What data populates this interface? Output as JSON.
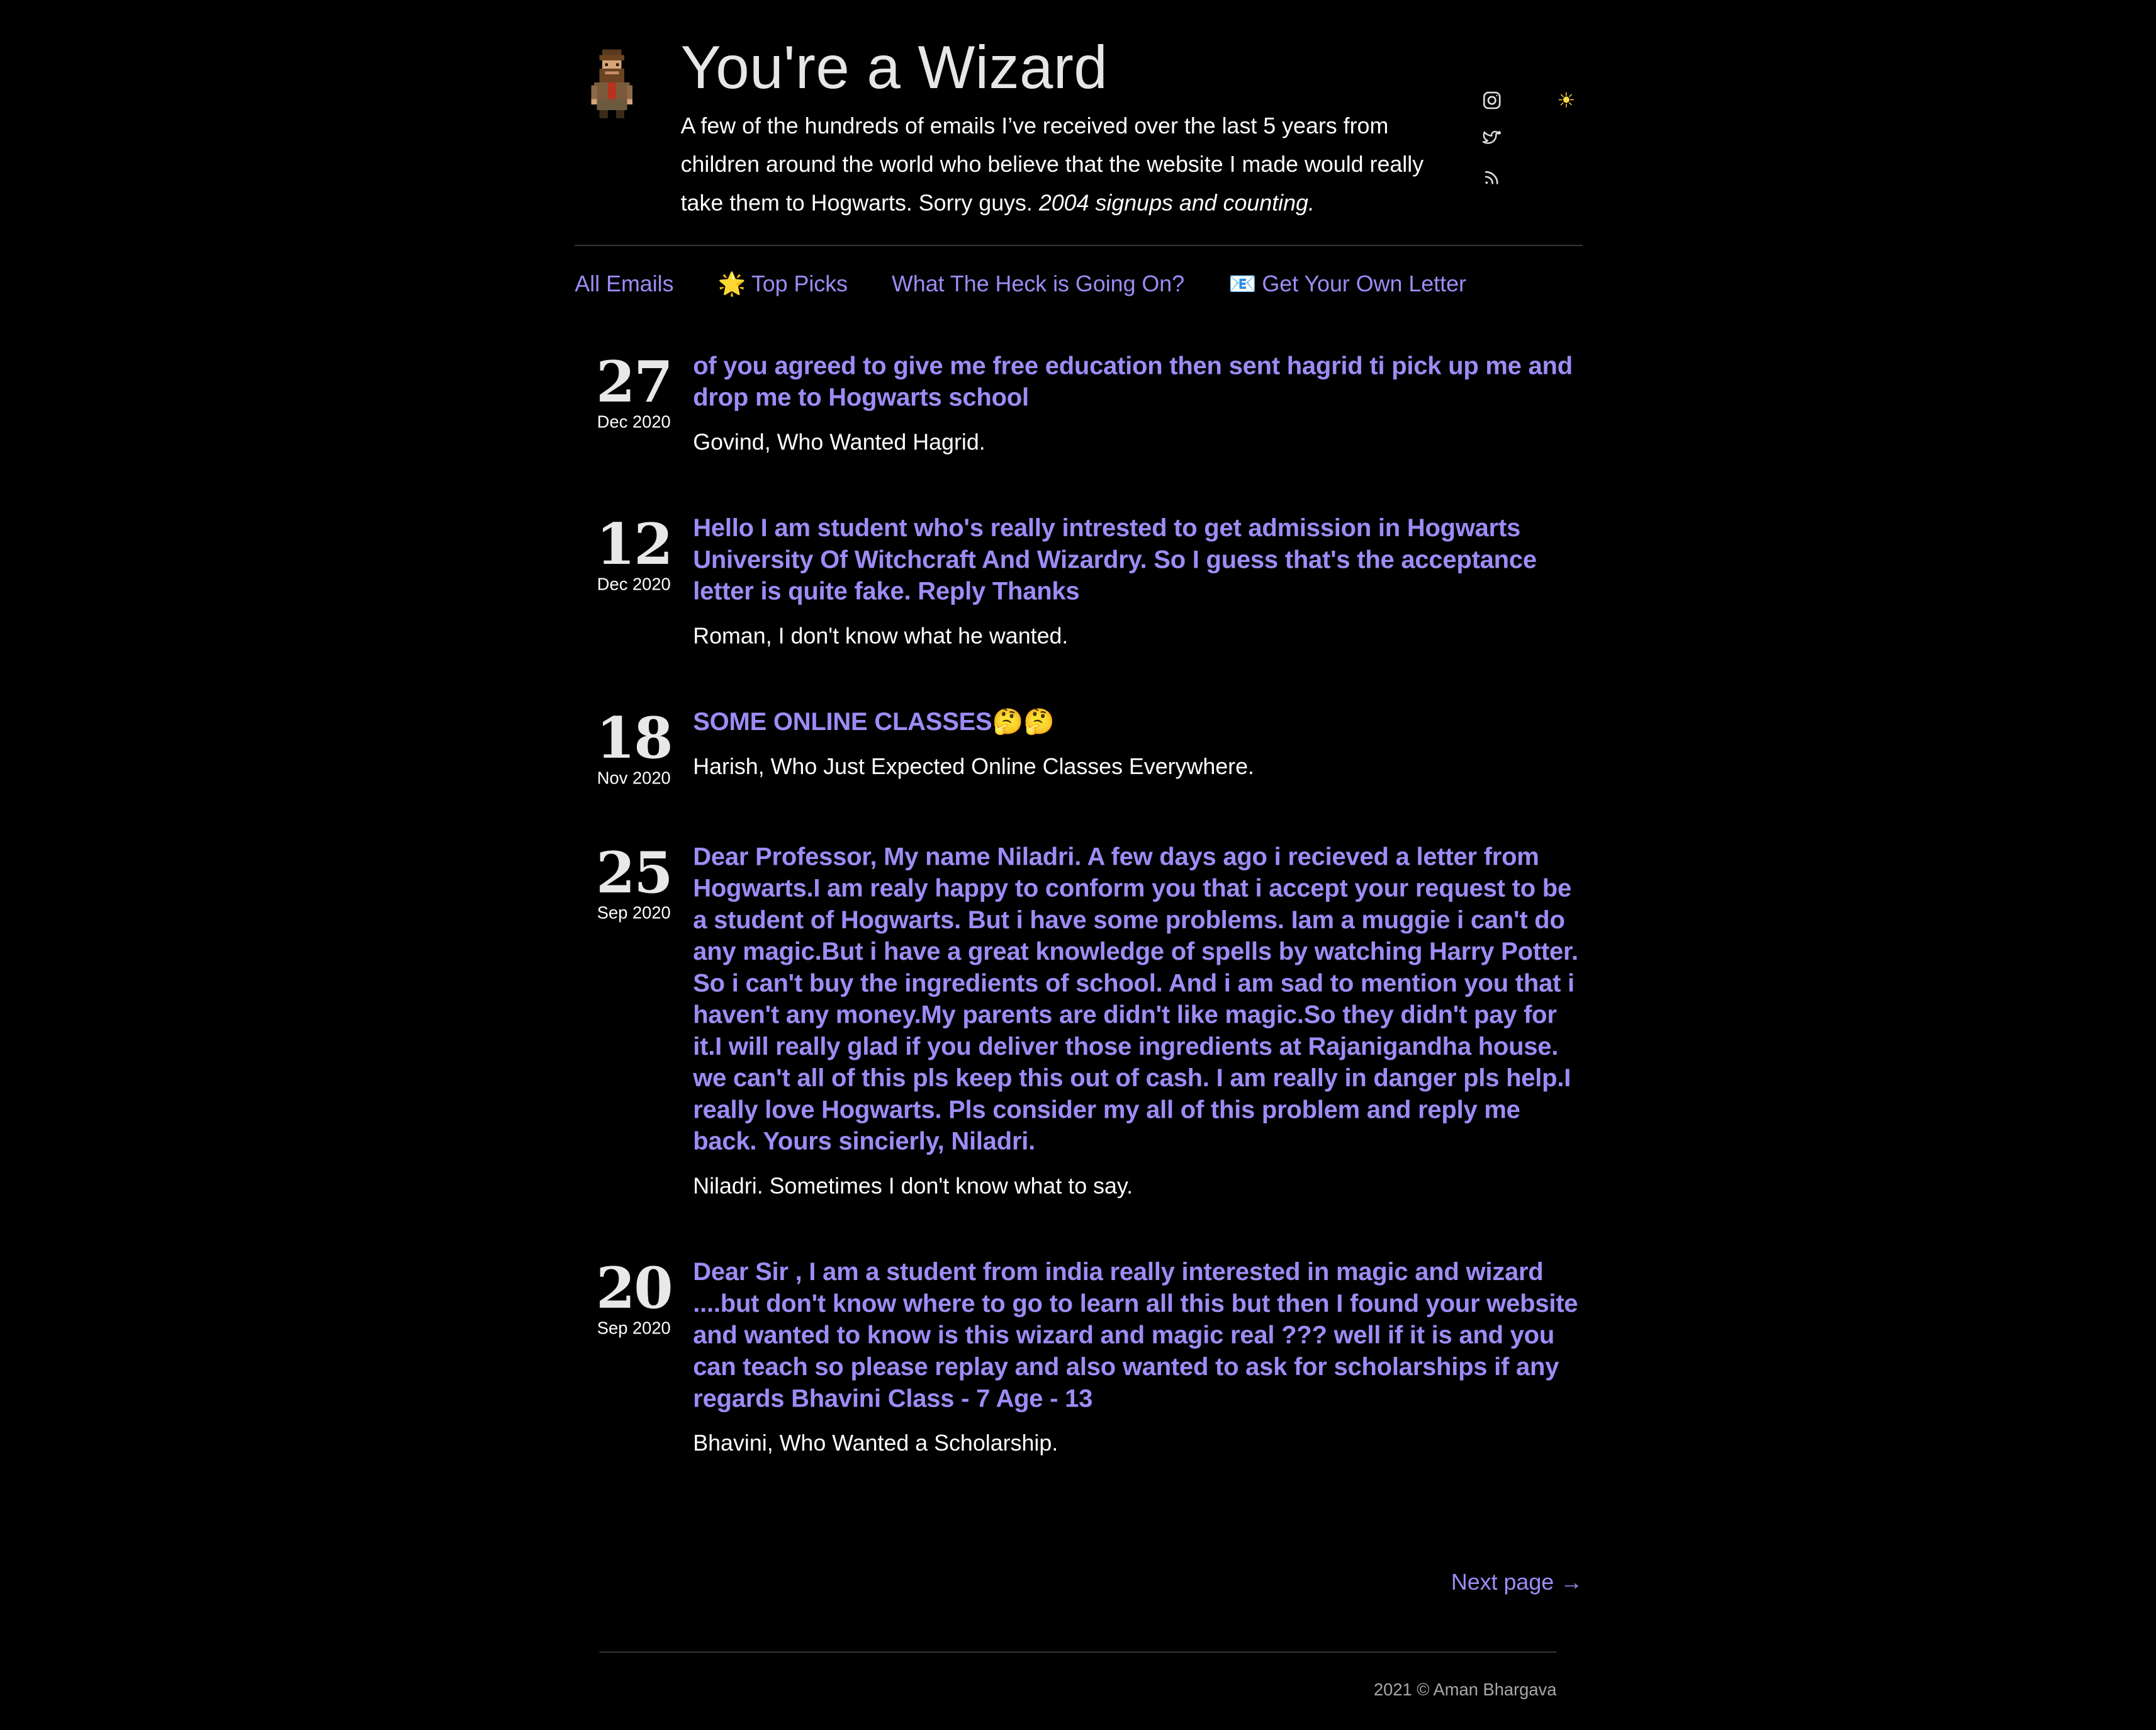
{
  "header": {
    "title": "You're a Wizard",
    "intro_text": "A few of the hundreds of emails I’ve received over the last 5 years from children around the world who believe that the website I made would really take them to Hogwarts. Sorry guys. ",
    "intro_emphasis": "2004 signups and counting.",
    "avatar_icon": "pixel-wizard-avatar",
    "social_icons": [
      "instagram-icon",
      "twitter-icon",
      "rss-icon"
    ],
    "theme_toggle_glyph": "☀",
    "theme_toggle_icon": "sun-icon"
  },
  "nav": {
    "all_emails": "All Emails",
    "top_picks_emoji": "🌟",
    "top_picks": "Top Picks",
    "what_the_heck": "What The Heck is Going On?",
    "get_letter_emoji": "📧",
    "get_letter": "Get Your Own Letter"
  },
  "entries": [
    {
      "day": "27",
      "month": "Dec 2020",
      "subject": "of you agreed to give me free education then sent hagrid ti pick up me and drop me to Hogwarts school",
      "signoff": "Govind, Who Wanted Hagrid."
    },
    {
      "day": "12",
      "month": "Dec 2020",
      "subject": "Hello I am student who's really intrested to get admission in Hogwarts University Of Witchcraft And Wizardry. So I guess that's the acceptance letter is quite fake. Reply Thanks",
      "signoff": "Roman, I don't know what he wanted."
    },
    {
      "day": "18",
      "month": "Nov 2020",
      "subject": "SOME ONLINE CLASSES🤔🤔",
      "signoff": "Harish, Who Just Expected Online Classes Everywhere."
    },
    {
      "day": "25",
      "month": "Sep 2020",
      "subject": "Dear Professor, My name Niladri. A few days ago i recieved a letter from Hogwarts.I am realy happy to conform you that i accept your request to be a student of Hogwarts. But i have some problems. Iam a muggie i can't do any magic.But i have a great knowledge of spells by watching Harry Potter. So i can't buy the ingredients of school. And i am sad to mention you that i haven't any money.My parents are didn't like magic.So they didn't pay for it.I will really glad if you deliver those ingredients at Rajanigandha house. we can't all of this pls keep this out of cash. I am really in danger pls help.I really love Hogwarts. Pls consider my all of this problem and reply me back. Yours sincierly, Niladri.",
      "signoff": "Niladri. Sometimes I don't know what to say."
    },
    {
      "day": "20",
      "month": "Sep 2020",
      "subject": "Dear Sir , I am a student from india really interested in magic and wizard ....but don't know where to go to learn all this but then I found your website and wanted to know is this wizard and magic real ??? well if it is and you can teach so please replay and also wanted to ask for scholarships if any regards Bhavini Class - 7 Age - 13",
      "signoff": "Bhavini, Who Wanted a Scholarship."
    }
  ],
  "pager": {
    "next_page": "Next page →"
  },
  "footer": {
    "copyright": "2021 © Aman Bhargava"
  },
  "colors": {
    "background": "#000000",
    "link": "#9d8cf5",
    "text": "#ffffff",
    "muted": "#a8a8a8",
    "rule": "#333333",
    "sun": "#ffd84a"
  }
}
